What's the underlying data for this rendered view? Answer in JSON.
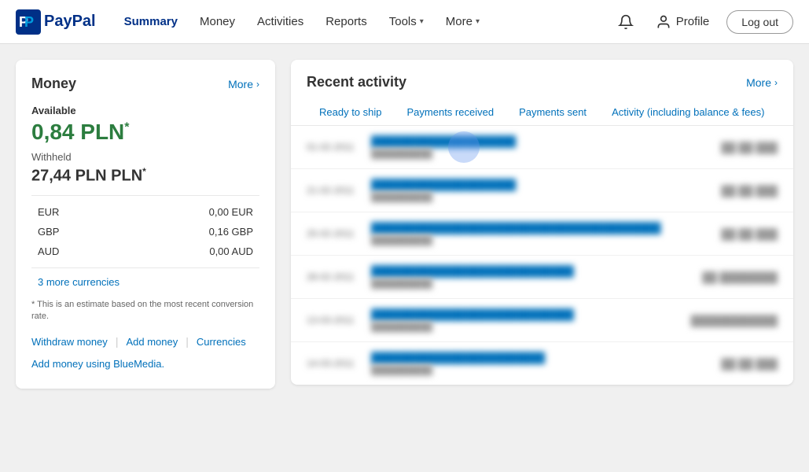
{
  "header": {
    "logo_alt": "PayPal",
    "nav": [
      {
        "label": "Summary",
        "id": "summary",
        "active": true,
        "hasDropdown": false
      },
      {
        "label": "Money",
        "id": "money",
        "active": false,
        "hasDropdown": false
      },
      {
        "label": "Activities",
        "id": "activities",
        "active": false,
        "hasDropdown": false
      },
      {
        "label": "Reports",
        "id": "reports",
        "active": false,
        "hasDropdown": false
      },
      {
        "label": "Tools",
        "id": "tools",
        "active": false,
        "hasDropdown": true
      },
      {
        "label": "More",
        "id": "more",
        "active": false,
        "hasDropdown": true
      }
    ],
    "profile_label": "Profile",
    "logout_label": "Log out"
  },
  "money_panel": {
    "title": "Money",
    "more_label": "More",
    "available_label": "Available",
    "main_balance": "0,84 PLN",
    "withheld_label": "Withheld",
    "withheld_amount": "27,44 PLN PLN",
    "currencies": [
      {
        "code": "EUR",
        "amount": "0,00 EUR"
      },
      {
        "code": "GBP",
        "amount": "0,16 GBP"
      },
      {
        "code": "AUD",
        "amount": "0,00 AUD"
      }
    ],
    "more_currencies_label": "3 more currencies",
    "estimate_note": "* This is an estimate based on the most recent conversion rate.",
    "actions": [
      {
        "label": "Withdraw money",
        "id": "withdraw"
      },
      {
        "label": "Add money",
        "id": "add"
      },
      {
        "label": "Currencies",
        "id": "currencies"
      }
    ],
    "bluemedia_label": "Add money using BlueMedia."
  },
  "activity_panel": {
    "title": "Recent activity",
    "more_label": "More",
    "tabs": [
      {
        "label": "Ready to ship",
        "id": "ready-to-ship",
        "active": false
      },
      {
        "label": "Payments received",
        "id": "payments-received",
        "active": false
      },
      {
        "label": "Payments sent",
        "id": "payments-sent",
        "active": false
      },
      {
        "label": "Activity (including balance & fees)",
        "id": "all-activity",
        "active": false
      }
    ],
    "rows": [
      {
        "date": "01-02-2011",
        "name": "████████████████████",
        "sub": "██████████",
        "amount": "██ ██ ███"
      },
      {
        "date": "21-02-2011",
        "name": "████████████████████",
        "sub": "██████████",
        "amount": "██ ██ ███"
      },
      {
        "date": "25-02-2011",
        "name": "████████████████████████████████████████",
        "sub": "██████████",
        "amount": "██ ██ ███"
      },
      {
        "date": "28-02-2011",
        "name": "████████████████████████████",
        "sub": "██████████",
        "amount": "██ ████████"
      },
      {
        "date": "13-03-2011",
        "name": "████████████████████████████",
        "sub": "██████████",
        "amount": "████████████"
      },
      {
        "date": "14-03-2011",
        "name": "████████████████████████",
        "sub": "██████████",
        "amount": "██ ██ ███"
      }
    ]
  }
}
